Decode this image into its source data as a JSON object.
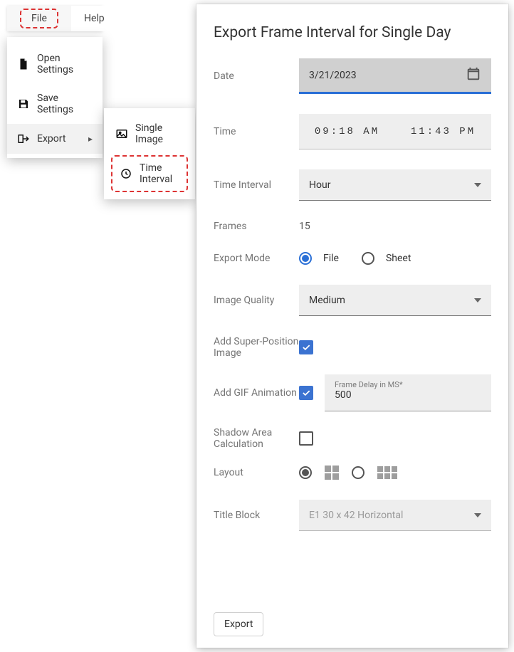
{
  "menubar": {
    "file": "File",
    "help": "Help"
  },
  "file_menu": {
    "open_settings": "Open Settings",
    "save_settings": "Save Settings",
    "export": "Export"
  },
  "export_submenu": {
    "single_image": "Single Image",
    "time_interval": "Time Interval"
  },
  "panel": {
    "title": "Export Frame Interval for Single Day",
    "labels": {
      "date": "Date",
      "time": "Time",
      "time_interval": "Time Interval",
      "frames": "Frames",
      "export_mode": "Export Mode",
      "image_quality": "Image Quality",
      "super_position": "Add Super-Position Image",
      "gif": "Add GIF Animation",
      "shadow": "Shadow Area Calculation",
      "layout": "Layout",
      "title_block": "Title Block"
    },
    "date": "3/21/2023",
    "time_start": "09:18 AM",
    "time_end": "11:43 PM",
    "interval": "Hour",
    "frames": "15",
    "mode": {
      "file": "File",
      "sheet": "Sheet",
      "selected": "file"
    },
    "quality": "Medium",
    "super_position_checked": true,
    "gif_checked": true,
    "gif_delay_label": "Frame Delay in MS*",
    "gif_delay_value": "500",
    "shadow_checked": false,
    "layout_selected": "single",
    "title_block": "E1 30 x 42 Horizontal",
    "export_button": "Export"
  }
}
